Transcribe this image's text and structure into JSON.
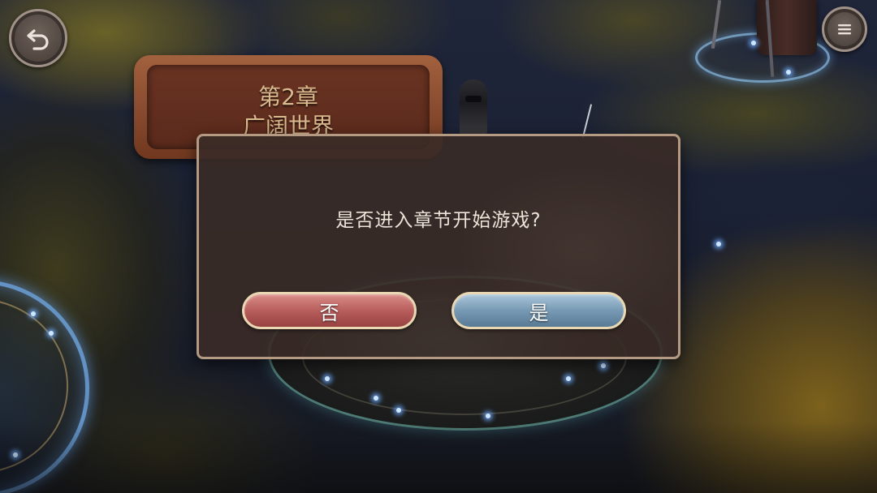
{
  "screen": "chapter-map",
  "hud": {
    "back_button_icon": "undo-arrow-icon",
    "menu_button_icon": "menu-icon"
  },
  "chapter_sign": {
    "number": "第2章",
    "name": "广阔世界"
  },
  "dialog": {
    "message": "是否进入章节开始游戏?",
    "cancel_label": "否",
    "confirm_label": "是"
  },
  "colors": {
    "cancel_button": "#b85e5c",
    "confirm_button": "#7799b3",
    "button_border": "#ead8b4",
    "dialog_border": "#b49a82",
    "chapter_sign": "#8a4c30",
    "glow": "#6ea5e1"
  }
}
